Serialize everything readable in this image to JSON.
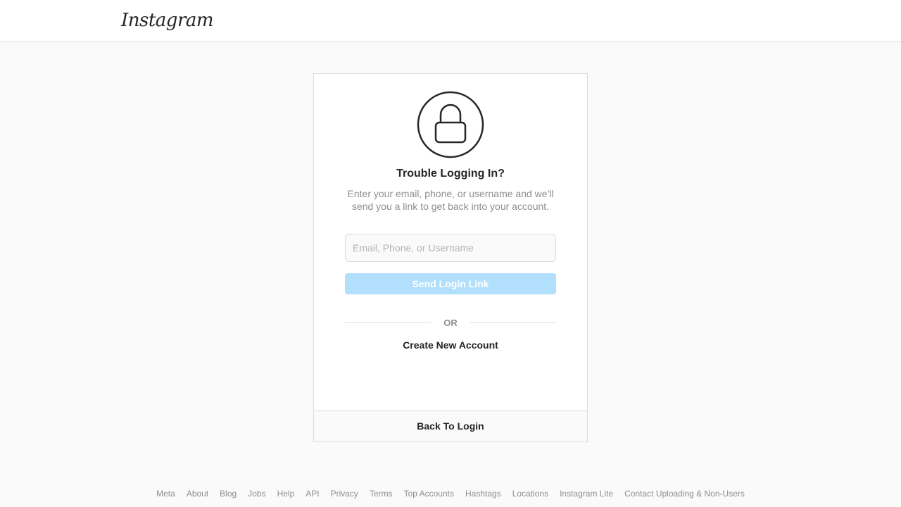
{
  "header": {
    "logo_text": "Instagram"
  },
  "card": {
    "icon": "lock-icon",
    "title": "Trouble Logging In?",
    "description": "Enter your email, phone, or username and we'll send you a link to get back into your account.",
    "input": {
      "placeholder": "Email, Phone, or Username",
      "value": ""
    },
    "send_button": "Send Login Link",
    "divider_text": "OR",
    "create_link": "Create New Account",
    "back_link": "Back To Login"
  },
  "footer": {
    "links": [
      "Meta",
      "About",
      "Blog",
      "Jobs",
      "Help",
      "API",
      "Privacy",
      "Terms",
      "Top Accounts",
      "Hashtags",
      "Locations",
      "Instagram Lite",
      "Contact Uploading & Non-Users"
    ]
  },
  "colors": {
    "background": "#fafafa",
    "border": "#dbdbdb",
    "button_disabled": "#b2dffc",
    "text": "#262626",
    "muted": "#8e8e8e"
  }
}
